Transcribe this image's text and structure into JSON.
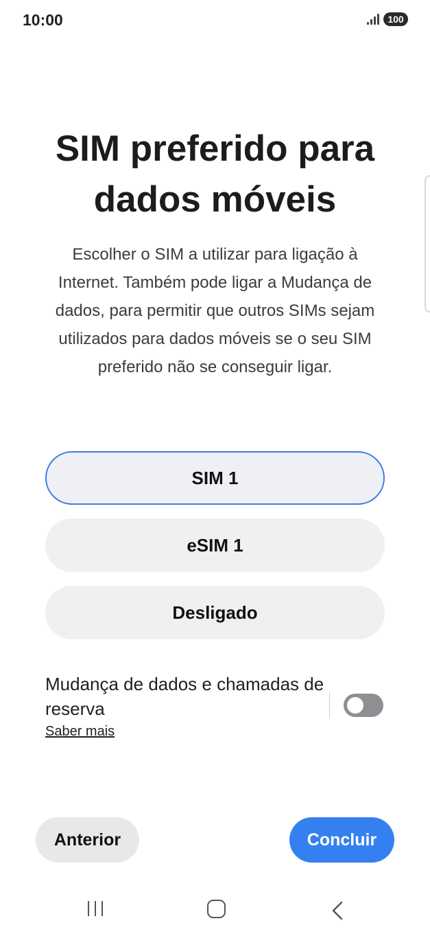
{
  "status_bar": {
    "time": "10:00",
    "battery": "100"
  },
  "header": {
    "title": "SIM preferido para dados móveis",
    "description": "Escolher o SIM a utilizar para ligação à Internet. Também pode ligar a Mudança de dados, para permitir que outros SIMs sejam utilizados para dados móveis se o seu SIM preferido não se conseguir ligar."
  },
  "options": [
    {
      "label": "SIM 1",
      "selected": true
    },
    {
      "label": "eSIM 1",
      "selected": false
    },
    {
      "label": "Desligado",
      "selected": false
    }
  ],
  "fallback": {
    "label": "Mudança de dados e chamadas de reserva",
    "learn_more": "Saber mais",
    "enabled": false
  },
  "buttons": {
    "previous": "Anterior",
    "done": "Concluir"
  },
  "colors": {
    "accent": "#3580f0",
    "selected_border": "#3f7be8",
    "toggle_off": "#8e8e93"
  },
  "icons": {
    "signal": "signal-icon",
    "battery": "battery-icon",
    "recent_apps": "recent-apps-icon",
    "home": "home-icon",
    "back": "back-icon"
  }
}
